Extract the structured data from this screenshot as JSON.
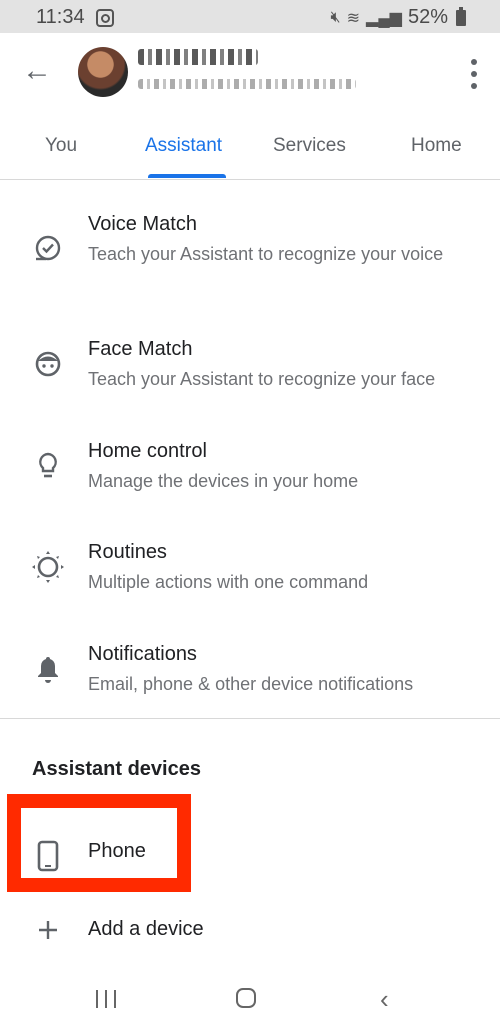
{
  "status_bar": {
    "time": "11:34",
    "battery_percent": "52%",
    "icons": [
      "instagram-icon",
      "mute-icon",
      "wifi-icon",
      "signal-icon",
      "battery-icon"
    ]
  },
  "header": {
    "back_icon": "arrow-left-icon",
    "account_name": "[redacted]",
    "account_email": "[redacted]",
    "more_icon": "more-vert-icon"
  },
  "tabs": [
    {
      "label": "You",
      "active": false
    },
    {
      "label": "Assistant",
      "active": true
    },
    {
      "label": "Services",
      "active": false
    },
    {
      "label": "Home",
      "active": false
    }
  ],
  "settings": [
    {
      "icon": "voice-match-icon",
      "title": "Voice Match",
      "subtitle": "Teach your Assistant to recognize your voice"
    },
    {
      "icon": "face-icon",
      "title": "Face Match",
      "subtitle": "Teach your Assistant to recognize your face"
    },
    {
      "icon": "lightbulb-icon",
      "title": "Home control",
      "subtitle": "Manage the devices in your home"
    },
    {
      "icon": "routines-icon",
      "title": "Routines",
      "subtitle": "Multiple actions with one command"
    },
    {
      "icon": "bell-icon",
      "title": "Notifications",
      "subtitle": "Email, phone & other device notifications"
    }
  ],
  "devices": {
    "section_title": "Assistant devices",
    "items": [
      {
        "icon": "phone-icon",
        "label": "Phone"
      }
    ],
    "add_label": "Add a device"
  },
  "colors": {
    "accent": "#1a73e8",
    "highlight": "#ff2a00"
  }
}
